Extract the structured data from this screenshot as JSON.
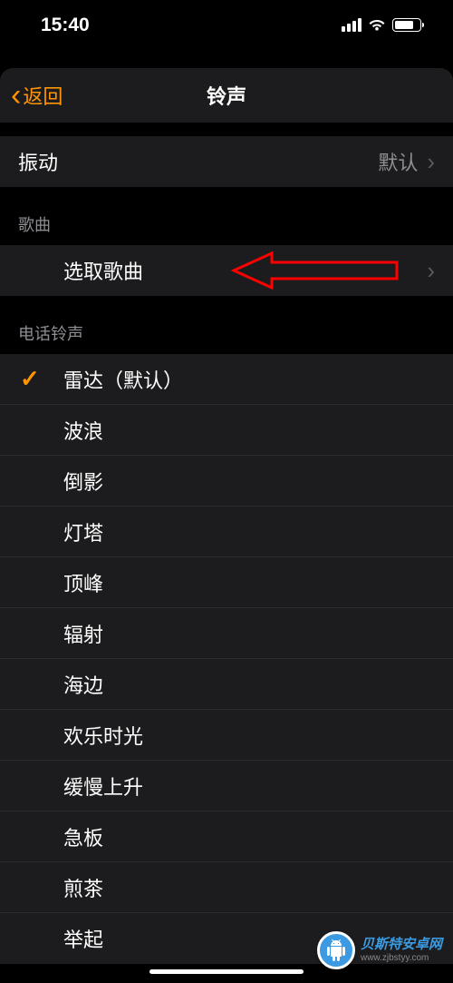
{
  "status_bar": {
    "time": "15:40"
  },
  "nav": {
    "back_label": "返回",
    "title": "铃声"
  },
  "vibration": {
    "label": "振动",
    "value": "默认"
  },
  "songs": {
    "header": "歌曲",
    "pick_label": "选取歌曲"
  },
  "ringtones": {
    "header": "电话铃声",
    "items": [
      {
        "label": "雷达（默认）",
        "selected": true
      },
      {
        "label": "波浪",
        "selected": false
      },
      {
        "label": "倒影",
        "selected": false
      },
      {
        "label": "灯塔",
        "selected": false
      },
      {
        "label": "顶峰",
        "selected": false
      },
      {
        "label": "辐射",
        "selected": false
      },
      {
        "label": "海边",
        "selected": false
      },
      {
        "label": "欢乐时光",
        "selected": false
      },
      {
        "label": "缓慢上升",
        "selected": false
      },
      {
        "label": "急板",
        "selected": false
      },
      {
        "label": "煎茶",
        "selected": false
      },
      {
        "label": "举起",
        "selected": false
      }
    ]
  },
  "watermark": {
    "title": "贝斯特安卓网",
    "url": "www.zjbstyy.com"
  }
}
